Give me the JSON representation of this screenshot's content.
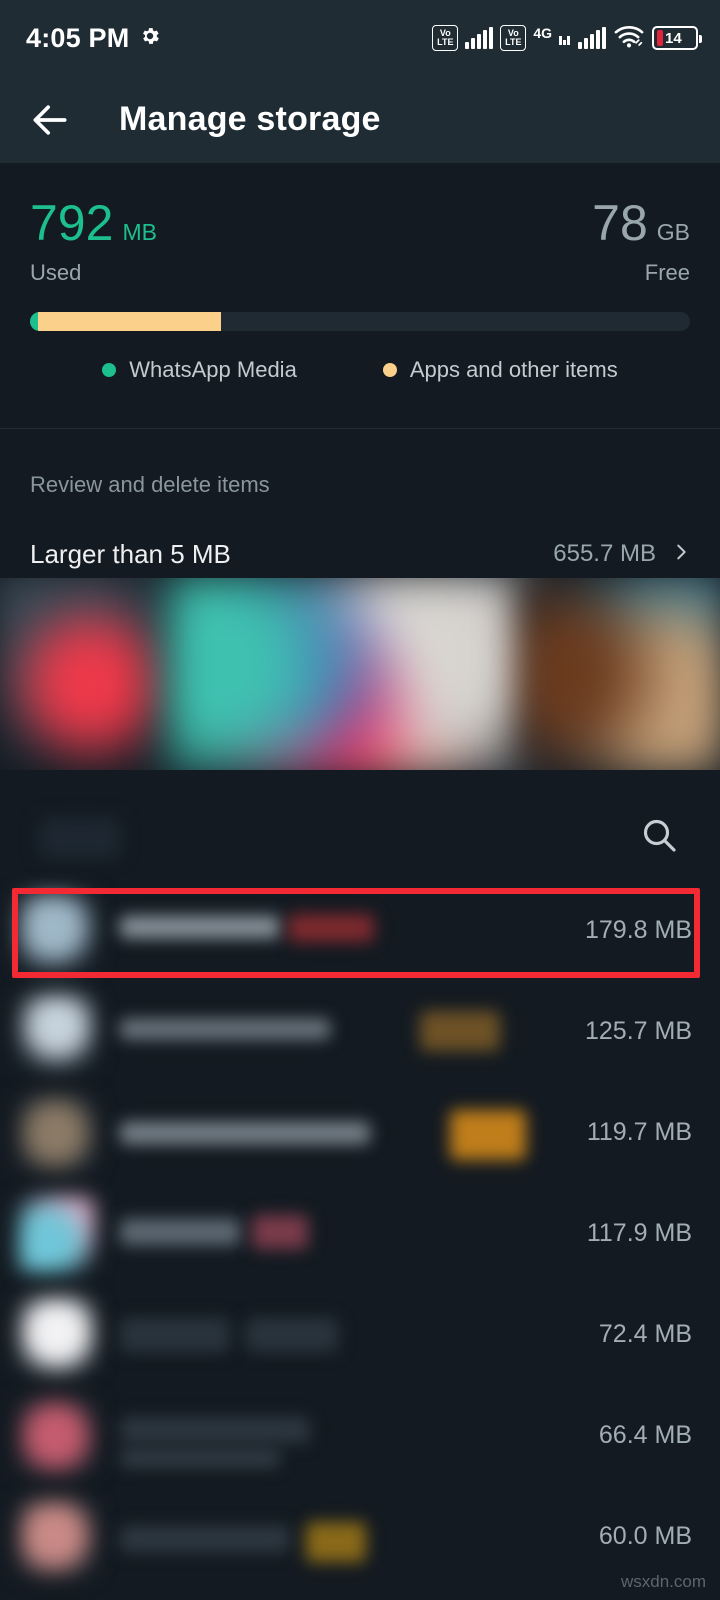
{
  "status_bar": {
    "time": "4:05 PM",
    "gear_icon": "gear-icon",
    "sim1_volte_top": "Vo",
    "sim1_volte_bottom": "LTE",
    "sim2_volte_top": "Vo",
    "sim2_volte_bottom": "LTE",
    "network_type": "4G",
    "wifi_icon": "wifi-icon",
    "battery_percent": "14"
  },
  "app_bar": {
    "back_icon": "back-arrow-icon",
    "title": "Manage storage"
  },
  "usage": {
    "used_value": "792",
    "used_unit": "MB",
    "used_caption": "Used",
    "free_value": "78",
    "free_unit": "GB",
    "free_caption": "Free",
    "bar_segments": [
      {
        "name": "WhatsApp Media",
        "percent": 1.2,
        "color": "#1DBF8E"
      },
      {
        "name": "Apps and other items",
        "percent": 27.8,
        "color": "#FBD08A"
      }
    ],
    "legend": [
      {
        "label": "WhatsApp Media",
        "color": "#1DBF8E"
      },
      {
        "label": "Apps and other items",
        "color": "#FBD08A"
      }
    ]
  },
  "review": {
    "section_title": "Review and delete items",
    "larger_than_label": "Larger than 5 MB",
    "larger_than_size": "655.7 MB",
    "chevron_icon": "chevron-right-icon"
  },
  "search": {
    "icon": "search-icon"
  },
  "file_list": {
    "rows": [
      {
        "size": "179.8 MB",
        "highlighted": true
      },
      {
        "size": "125.7 MB",
        "highlighted": false
      },
      {
        "size": "119.7 MB",
        "highlighted": false
      },
      {
        "size": "117.9 MB",
        "highlighted": false
      },
      {
        "size": "72.4 MB",
        "highlighted": false
      },
      {
        "size": "66.4 MB",
        "highlighted": false
      },
      {
        "size": "60.0 MB",
        "highlighted": false
      }
    ]
  },
  "annotation": {
    "highlight_color": "#F32A33"
  },
  "watermark": {
    "text": "wsxdn.com"
  },
  "theme": {
    "app_bar_bg": "#1F2C33",
    "body_bg": "#131A21",
    "accent_green": "#1DBF8E",
    "accent_amber": "#FBD08A",
    "text_primary": "#EDEFF1",
    "text_secondary": "#9AA6AD"
  }
}
